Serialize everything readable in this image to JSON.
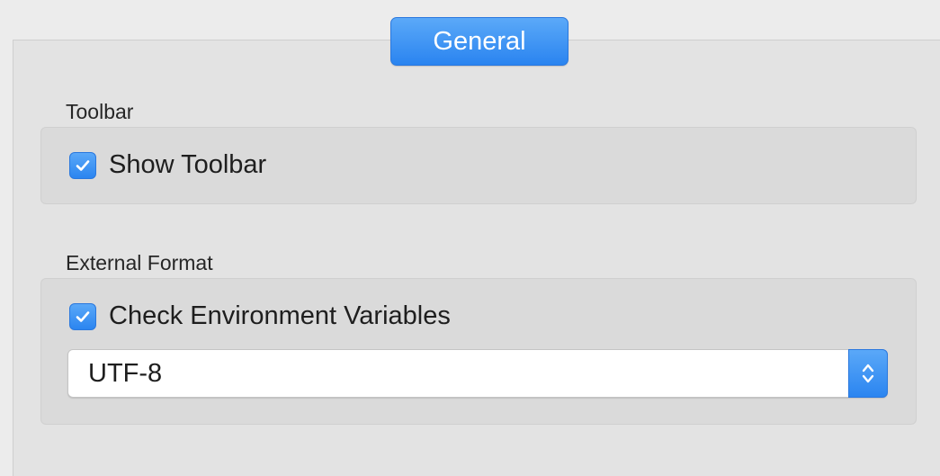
{
  "tabs": [
    {
      "label": "General",
      "selected": true
    }
  ],
  "toolbar_section": {
    "label": "Toolbar",
    "show_toolbar": {
      "label": "Show Toolbar",
      "checked": true
    }
  },
  "external_format_section": {
    "label": "External Format",
    "check_env": {
      "label": "Check Environment Variables",
      "checked": true
    },
    "encoding_select": {
      "value": "UTF-8"
    }
  },
  "colors": {
    "accent": "#2b85f0",
    "panel": "#e3e3e3",
    "group": "#dadada"
  }
}
